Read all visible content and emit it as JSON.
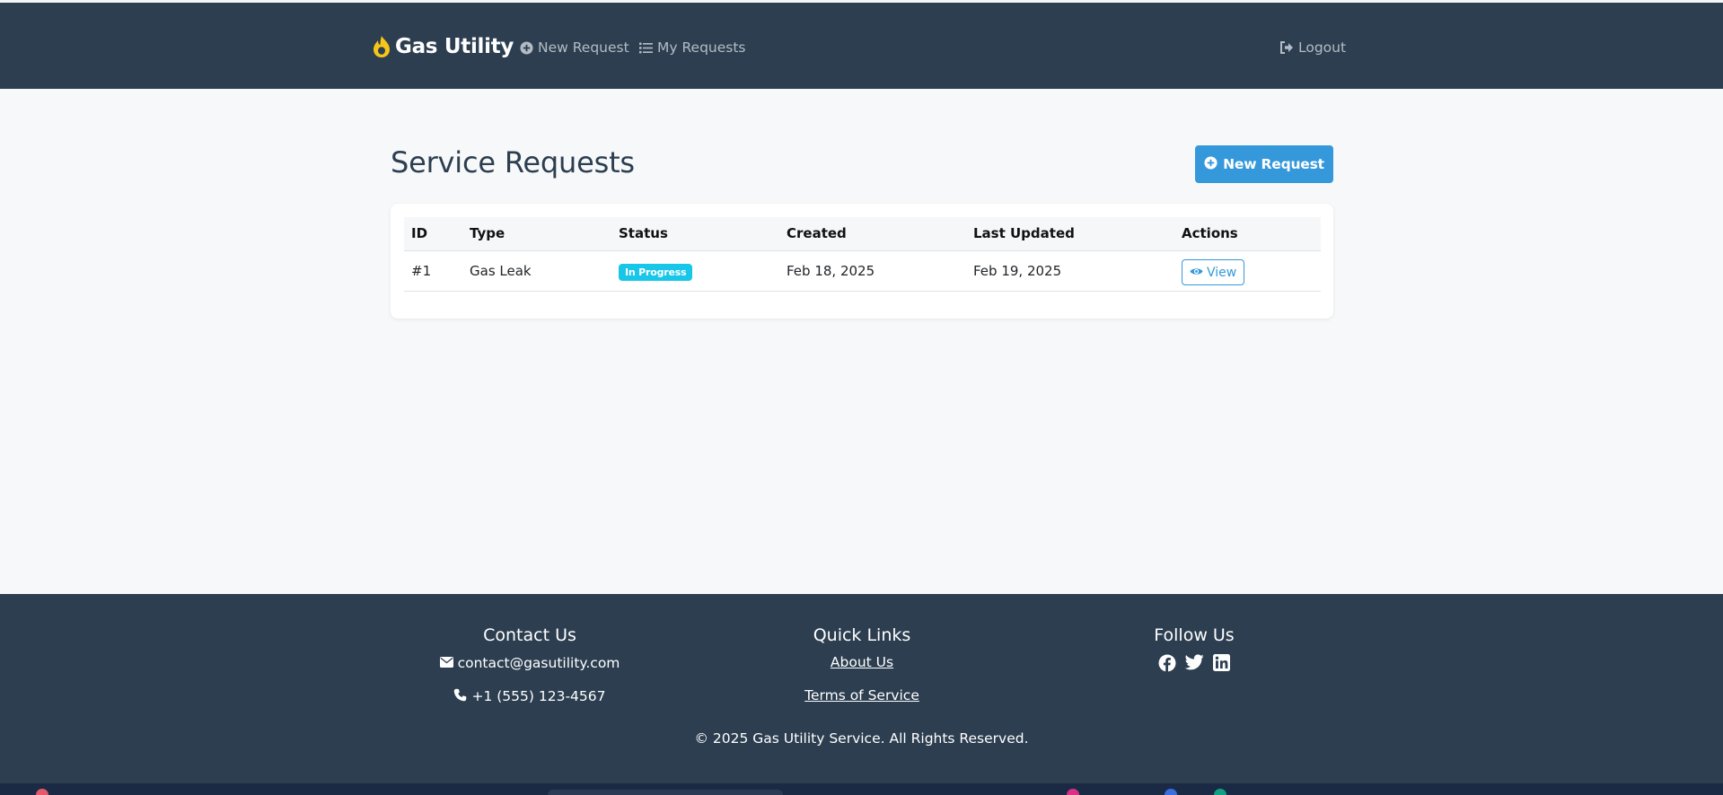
{
  "navbar": {
    "brand": "Gas Utility",
    "links": {
      "new_request": "New Request",
      "my_requests": "My Requests",
      "logout": "Logout"
    }
  },
  "main": {
    "title": "Service Requests",
    "new_request_button": "New Request",
    "table": {
      "headers": {
        "id": "ID",
        "type": "Type",
        "status": "Status",
        "created": "Created",
        "updated": "Last Updated",
        "actions": "Actions"
      },
      "rows": [
        {
          "id": "#1",
          "type": "Gas Leak",
          "status": "In Progress",
          "created": "Feb 18, 2025",
          "updated": "Feb 19, 2025",
          "action": "View"
        }
      ]
    }
  },
  "footer": {
    "contact": {
      "title": "Contact Us",
      "email": "contact@gasutility.com",
      "phone": "+1 (555) 123-4567"
    },
    "quick_links": {
      "title": "Quick Links",
      "about": "About Us",
      "terms": "Terms of Service"
    },
    "follow": {
      "title": "Follow Us",
      "icons": [
        "facebook-icon",
        "twitter-icon",
        "linkedin-icon"
      ]
    },
    "copyright": "© 2025 Gas Utility Service. All Rights Reserved."
  },
  "colors": {
    "navbar": "#2c3e50",
    "accent": "#3498db",
    "brand_icon": "#f5c518",
    "status_badge": "#17c6e8"
  }
}
